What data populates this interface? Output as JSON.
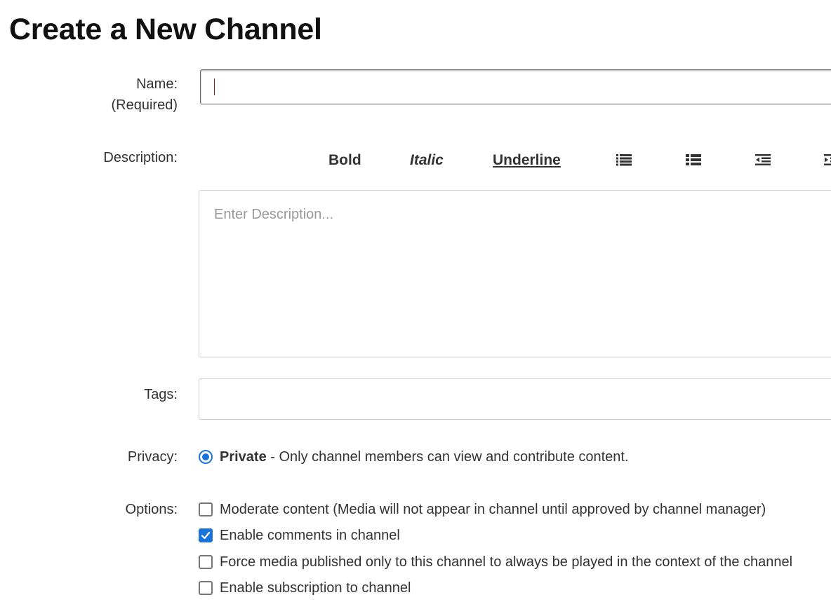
{
  "page": {
    "title": "Create a New Channel"
  },
  "form": {
    "name": {
      "label": "Name:",
      "required": "(Required)",
      "value": ""
    },
    "description": {
      "label": "Description:",
      "placeholder": "Enter Description...",
      "toolbar": {
        "bold": "Bold",
        "italic": "Italic",
        "underline": "Underline",
        "icons": [
          "bulleted-list-icon",
          "numbered-list-icon",
          "outdent-icon",
          "indent-icon"
        ]
      }
    },
    "tags": {
      "label": "Tags:",
      "value": ""
    },
    "privacy": {
      "label": "Privacy:",
      "option_name": "Private",
      "option_desc": " - Only channel members can view and contribute content.",
      "selected": true
    },
    "options": {
      "label": "Options:",
      "items": [
        {
          "label": "Moderate content (Media will not appear in channel until approved by channel manager)",
          "checked": false
        },
        {
          "label": "Enable comments in channel",
          "checked": true
        },
        {
          "label": "Force media published only to this channel to always be played in the context of the channel",
          "checked": false
        },
        {
          "label": "Enable subscription to channel",
          "checked": false
        }
      ]
    }
  },
  "colors": {
    "accent": "#1a73d9",
    "text": "#333333",
    "placeholder": "#999999"
  }
}
